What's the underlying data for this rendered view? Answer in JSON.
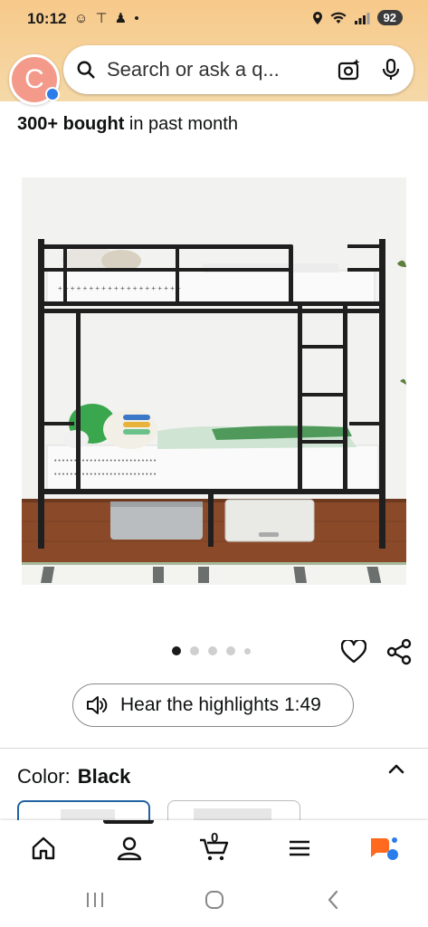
{
  "status_bar": {
    "time": "10:12",
    "left_icons": "☺ ⊤ ♟ •",
    "battery": "92"
  },
  "header": {
    "avatar_letter": "C",
    "search_placeholder": "Search or ask a q..."
  },
  "product": {
    "bought_count": "300+ bought",
    "bought_suffix": " in past month",
    "image_alt": "Black metal bunk bed with ladder and white mattresses",
    "carousel": {
      "total": 5,
      "active": 1
    }
  },
  "highlights": {
    "label": "Hear the highlights 1:49"
  },
  "color_selector": {
    "label": "Color:",
    "value": "Black"
  },
  "bottom_nav": {
    "cart_count": "0",
    "items": [
      "home",
      "account",
      "cart",
      "menu",
      "rufus"
    ]
  },
  "colors": {
    "header_gradient_top": "#f7c98a",
    "selected_border": "#2162a1",
    "rufus_orange": "#ff6a1f",
    "rufus_blue": "#2b7de9"
  }
}
